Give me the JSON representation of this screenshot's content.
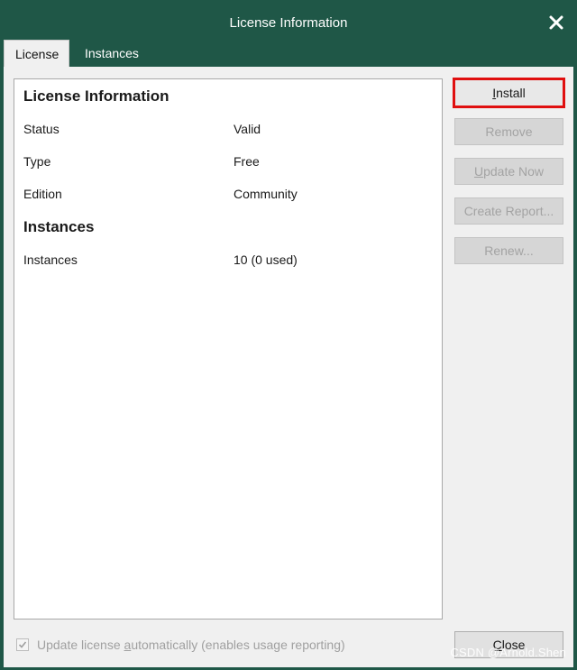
{
  "window": {
    "title": "License Information"
  },
  "tabs": [
    {
      "label": "License",
      "active": true
    },
    {
      "label": "Instances",
      "active": false
    }
  ],
  "license_section": {
    "title": "License Information",
    "rows": [
      {
        "label": "Status",
        "value": "Valid"
      },
      {
        "label": "Type",
        "value": "Free"
      },
      {
        "label": "Edition",
        "value": "Community"
      }
    ]
  },
  "instances_section": {
    "title": "Instances",
    "rows": [
      {
        "label": "Instances",
        "value": "10 (0 used)"
      }
    ]
  },
  "buttons": {
    "install": {
      "pre": "",
      "key": "I",
      "post": "nstall",
      "enabled": true
    },
    "remove": {
      "label": "Remove",
      "enabled": false
    },
    "update_now": {
      "pre": "",
      "key": "U",
      "post": "pdate Now",
      "enabled": false
    },
    "create_report": {
      "label": "Create Report...",
      "enabled": false
    },
    "renew": {
      "label": "Renew...",
      "enabled": false
    },
    "close": {
      "pre": "",
      "key": "C",
      "post": "lose",
      "enabled": true
    }
  },
  "footer": {
    "auto_update": {
      "pre": "Update license ",
      "key": "a",
      "post": "utomatically (enables usage reporting)",
      "checked": true,
      "enabled": false
    }
  },
  "watermark": "CSDN @Arnold.Shen",
  "colors": {
    "titlebar": "#1f5747",
    "highlight": "#e01010"
  },
  "icons": {
    "close": "close-icon",
    "checkbox": "checkmark-icon"
  }
}
